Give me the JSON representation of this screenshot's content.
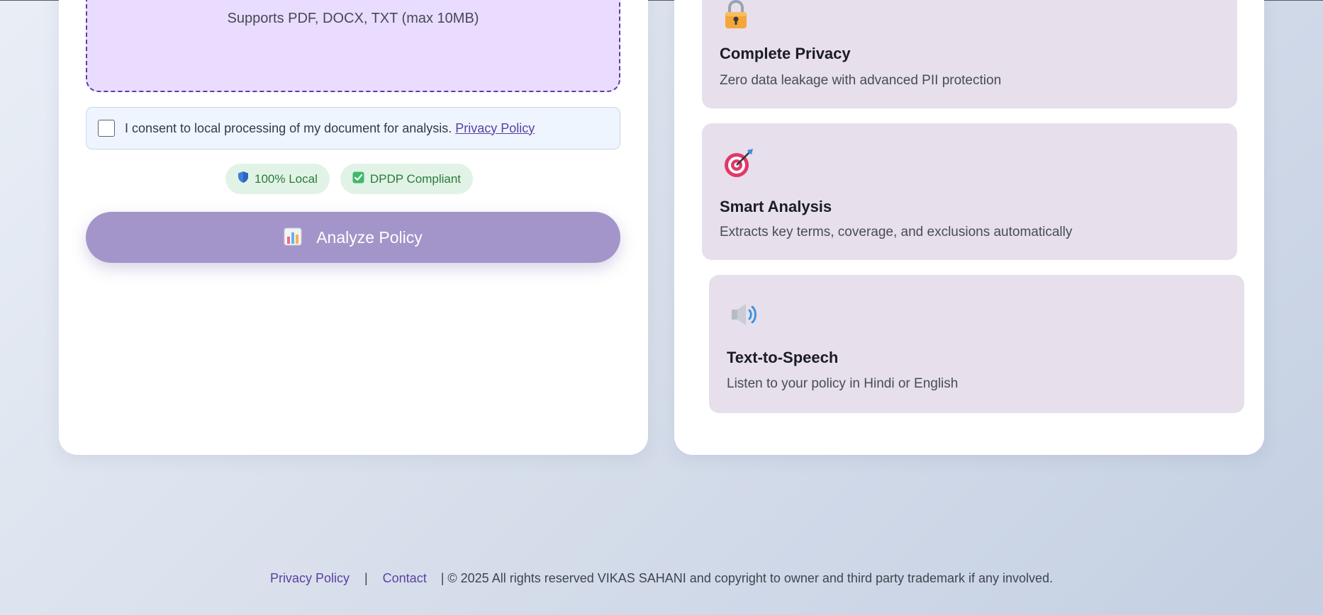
{
  "upload": {
    "supported_formats": "Supports PDF, DOCX, TXT (max 10MB)"
  },
  "consent": {
    "text": "I consent to local processing of my document for analysis.",
    "link_label": "Privacy Policy",
    "checked": false
  },
  "badges": [
    {
      "label": "100% Local",
      "icon": "shield-icon"
    },
    {
      "label": "DPDP Compliant",
      "icon": "check-box-icon"
    }
  ],
  "analyze_button": {
    "label": "Analyze Policy",
    "icon": "bar-chart-icon"
  },
  "features": [
    {
      "title": "Complete Privacy",
      "description": "Zero data leakage with advanced PII protection",
      "icon": "lock-icon"
    },
    {
      "title": "Smart Analysis",
      "description": "Extracts key terms, coverage, and exclusions automatically",
      "icon": "target-icon"
    },
    {
      "title": "Text-to-Speech",
      "description": "Listen to your policy in Hindi or English",
      "icon": "speaker-icon"
    }
  ],
  "footer": {
    "privacy_link": "Privacy Policy",
    "separator": "|",
    "contact_link": "Contact",
    "copyright": "| © 2025 All rights reserved VIKAS SAHANI and copyright to owner and third party trademark if any involved."
  },
  "colors": {
    "accent": "#5b3fa0",
    "button": "#a395c9",
    "dropzone_bg": "#eadcff",
    "feature_bg": "#e7dfeb",
    "badge_bg": "#e1f3e6",
    "badge_text": "#2b7a3a"
  }
}
